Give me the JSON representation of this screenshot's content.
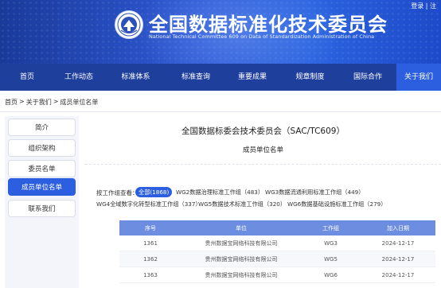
{
  "header": {
    "title_cn": "全国数据标准化技术委员会",
    "title_en": "National Technical Committee 609 on Data of Standardization Administration of China",
    "login": "登录 | 注"
  },
  "nav": {
    "items": [
      {
        "label": "首页",
        "active": false
      },
      {
        "label": "工作动态",
        "active": false
      },
      {
        "label": "标准体系",
        "active": false
      },
      {
        "label": "标准查询",
        "active": false
      },
      {
        "label": "重要成果",
        "active": false
      },
      {
        "label": "规章制度",
        "active": false
      },
      {
        "label": "国际合作",
        "active": false
      },
      {
        "label": "关于我们",
        "active": true
      }
    ]
  },
  "breadcrumb": {
    "home": "首页",
    "sep1": ">",
    "about": "关于我们",
    "sep2": ">",
    "current": "成员单位名单"
  },
  "sidebar": {
    "items": [
      {
        "label": "简介",
        "active": false
      },
      {
        "label": "组织架构",
        "active": false
      },
      {
        "label": "委员名单",
        "active": false
      },
      {
        "label": "成员单位名单",
        "active": true
      },
      {
        "label": "联系我们",
        "active": false
      }
    ]
  },
  "main": {
    "title": "全国数据标委会技术委员会（SAC/TC609）",
    "subtitle": "成员单位名单"
  },
  "filter": {
    "label": "按工作组查看：",
    "chips": [
      {
        "label": "全部(1868)",
        "active": true
      },
      {
        "label": "WG2数据治理标准工作组（483）",
        "active": false
      },
      {
        "label": "WG3数据流通利用标准工作组（449）",
        "active": false
      },
      {
        "label": "WG4全域数字化转型标准工作组（337）",
        "active": false
      },
      {
        "label": "WG5数据技术标准工作组（320）",
        "active": false
      },
      {
        "label": "WG6数据基础设施标准工作组（279）",
        "active": false
      }
    ]
  },
  "table": {
    "columns": [
      "序号",
      "单位",
      "工作组",
      "加入日期"
    ],
    "rows": [
      [
        "1361",
        "贵州数据宝网络科技有限公司",
        "WG3",
        "2024-12-17"
      ],
      [
        "1362",
        "贵州数据宝网络科技有限公司",
        "WG5",
        "2024-12-17"
      ],
      [
        "1363",
        "贵州数据宝网络科技有限公司",
        "WG6",
        "2024-12-17"
      ]
    ]
  },
  "colors": {
    "banner": "#2f5ad6",
    "nav": "#1f3f9c",
    "accent": "#2c5fe0",
    "table_header": "#6d8ee0"
  },
  "icons": {
    "logo": "committee-emblem-icon"
  }
}
